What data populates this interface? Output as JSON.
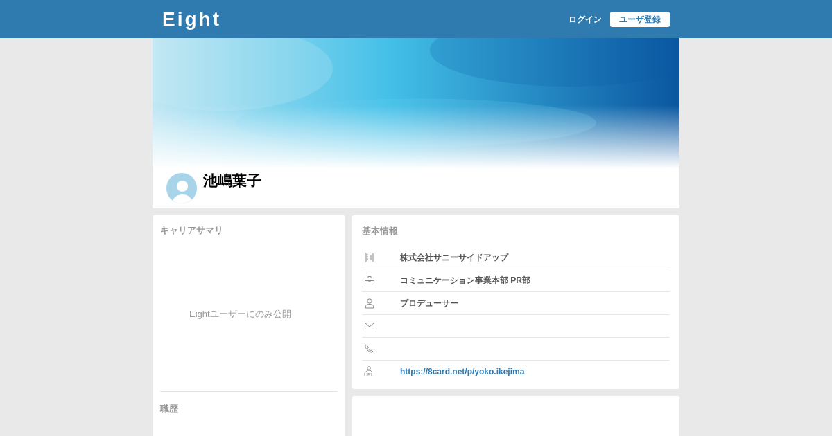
{
  "header": {
    "logo": "Eight",
    "login": "ログイン",
    "register": "ユーザ登録"
  },
  "profile": {
    "name": "池嶋葉子"
  },
  "career": {
    "title": "キャリアサマリ",
    "notice": "Eightユーザーにのみ公開",
    "history_title": "職歴"
  },
  "basic_info": {
    "title": "基本情報",
    "rows": [
      {
        "kind": "company",
        "value": "株式会社サニーサイドアップ"
      },
      {
        "kind": "department",
        "value": "コミュニケーション事業本部 PR部"
      },
      {
        "kind": "title",
        "value": "プロデューサー"
      },
      {
        "kind": "email"
      },
      {
        "kind": "phone"
      },
      {
        "kind": "url",
        "icon_label": "URL",
        "value": "https://8card.net/p/yoko.ikejima"
      }
    ]
  }
}
